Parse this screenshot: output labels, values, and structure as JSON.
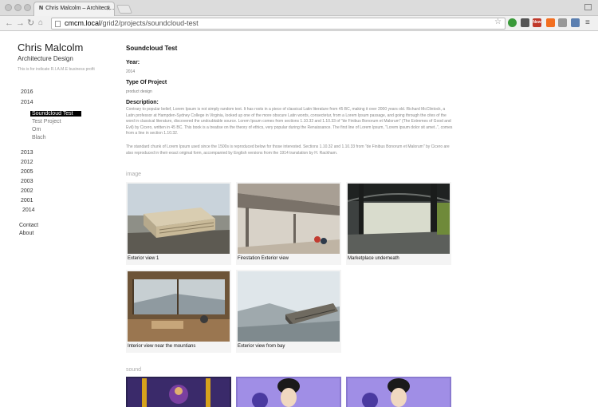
{
  "browser": {
    "tab_title": "Chris Malcolm – Architecti...",
    "tab_favicon": "N",
    "url_host": "cmcm.local",
    "url_path": "/grid2/projects/soundcloud-test",
    "extension_badge": "New"
  },
  "site": {
    "title": "Chris Malcolm",
    "subtitle": "Architecture Design",
    "tagline": "This is for indicate R.I.A.M.E business profit"
  },
  "sidebar": {
    "items": [
      {
        "label": "2016"
      },
      {
        "label": "2014"
      },
      {
        "label": "Soundcloud Test"
      },
      {
        "label": "Test Project"
      },
      {
        "label": "Om"
      },
      {
        "label": "Blach"
      },
      {
        "label": "2013"
      },
      {
        "label": "2012"
      },
      {
        "label": "2005"
      },
      {
        "label": "2003"
      },
      {
        "label": "2002"
      },
      {
        "label": "2001"
      },
      {
        "label": "2014"
      },
      {
        "label": "Contact"
      },
      {
        "label": "About"
      }
    ]
  },
  "project": {
    "title": "Soundcloud Test",
    "year_label": "Year:",
    "year_value": "2014",
    "type_label": "Type Of Project",
    "type_value": "product design",
    "desc_label": "Description:",
    "desc_p1": "Contrary to popular belief, Lorem Ipsum is not simply random text. It has roots in a piece of classical Latin literature from 45 BC, making it over 2000 years old. Richard McClintock, a Latin professor at Hampden-Sydney College in Virginia, looked up one of the more obscure Latin words, consectetur, from a Lorem Ipsum passage, and going through the cites of the word in classical literature, discovered the undoubtable source. Lorem Ipsum comes from sections 1.10.32 and 1.10.33 of \"de Finibus Bonorum et Malorum\" (The Extremes of Good and Evil) by Cicero, written in 45 BC. This book is a treatise on the theory of ethics, very popular during the Renaissance. The first line of Lorem Ipsum, \"Lorem ipsum dolor sit amet..\", comes from a line in section 1.10.32.",
    "desc_p2": "The standard chunk of Lorem Ipsum used since the 1500s is reproduced below for those interested. Sections 1.10.32 and 1.10.33 from \"de Finibus Bonorum et Malorum\" by Cicero are also reproduced in their exact original form, accompanied by English versions from the 1914 translation by H. Rackham."
  },
  "gallery": {
    "image_label": "image",
    "images": [
      {
        "caption": "Exterior view 1"
      },
      {
        "caption": "Firestation Exterior view"
      },
      {
        "caption": "Marketplace underneath"
      },
      {
        "caption": "Interior view near the mountians"
      },
      {
        "caption": "Exterior view from bay"
      }
    ],
    "sound_label": "sound"
  }
}
